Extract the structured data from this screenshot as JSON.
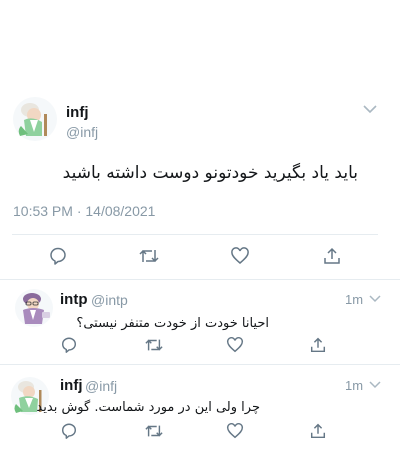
{
  "main_tweet": {
    "author_name": "infj",
    "author_handle": "@infj",
    "text": "باید یاد بگیرید خودتونو دوست داشته باشید",
    "timestamp": "10:53 PM · 14/08/2021",
    "actions": [
      "reply-icon",
      "retweet-icon",
      "like-icon",
      "share-icon"
    ]
  },
  "replies": [
    {
      "author_name": "intp",
      "author_handle": "@intp",
      "time": "1m",
      "text": "احیانا خودت از خودت متنفر نیستی؟"
    },
    {
      "author_name": "infj",
      "author_handle": "@infj",
      "time": "1m",
      "text": "چرا ولی این در مورد شماست. گوش بدید"
    }
  ],
  "colors": {
    "text": "#14171a",
    "secondary": "#8899a6",
    "divider": "#e6ecf0",
    "icon": "#657786"
  }
}
